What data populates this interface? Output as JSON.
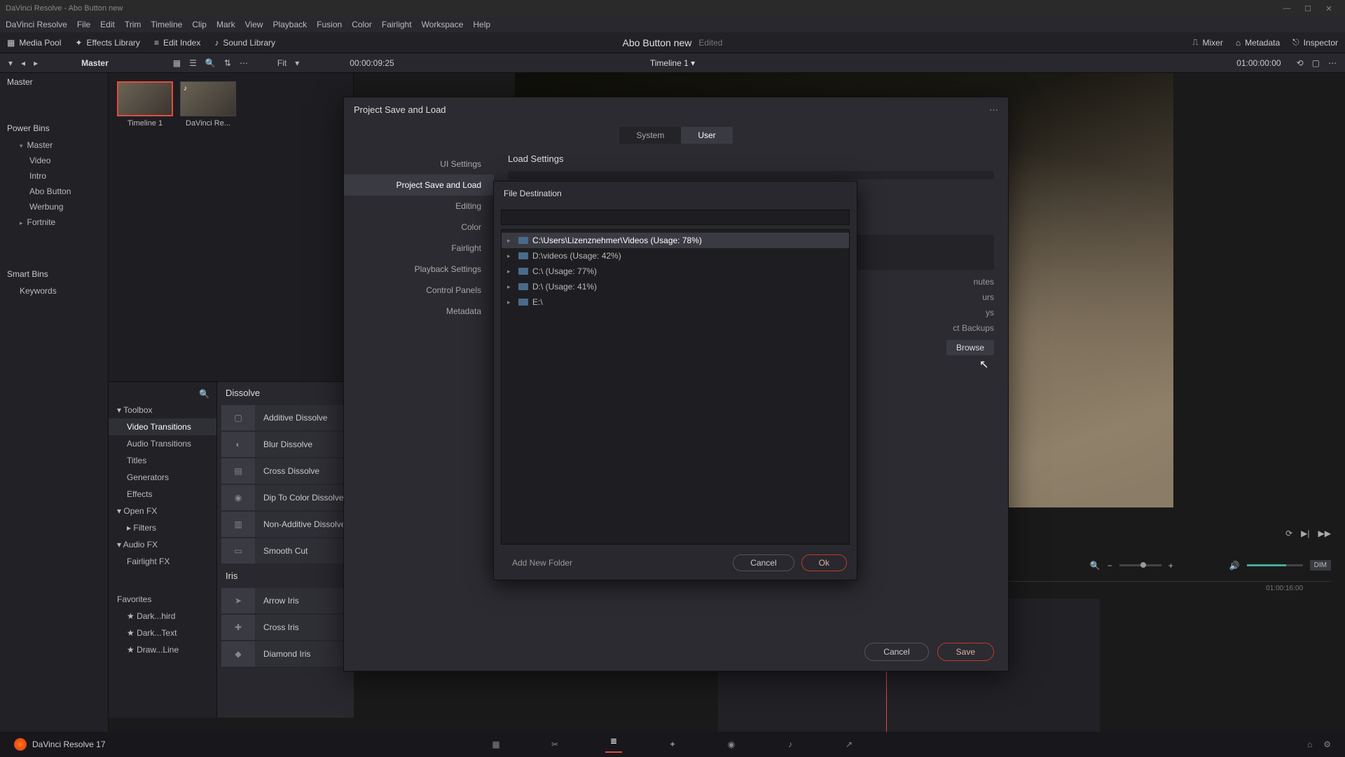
{
  "titlebar": {
    "text": "DaVinci Resolve - Abo Button new"
  },
  "menubar": [
    "DaVinci Resolve",
    "File",
    "Edit",
    "Trim",
    "Timeline",
    "Clip",
    "Mark",
    "View",
    "Playback",
    "Fusion",
    "Color",
    "Fairlight",
    "Workspace",
    "Help"
  ],
  "toolbar": {
    "media_pool": "Media Pool",
    "effects_library": "Effects Library",
    "edit_index": "Edit Index",
    "sound_library": "Sound Library",
    "project_name": "Abo Button new",
    "project_status": "Edited",
    "mixer": "Mixer",
    "metadata": "Metadata",
    "inspector": "Inspector"
  },
  "topstrip": {
    "master": "Master",
    "fit": "Fit",
    "tc_left": "00:00:09:25",
    "timeline": "Timeline 1",
    "tc_right": "01:00:00:00"
  },
  "media_tree": {
    "master_hdr": "Master",
    "power_bins": "Power Bins",
    "master": "Master",
    "items": [
      "Video",
      "Intro",
      "Abo Button",
      "Werbung",
      "Fortnite"
    ],
    "smart_bins": "Smart Bins",
    "keywords": "Keywords"
  },
  "thumbs": [
    {
      "label": "Timeline 1"
    },
    {
      "label": "DaVinci Re..."
    }
  ],
  "fx_tree": {
    "toolbox": "Toolbox",
    "items": [
      "Video Transitions",
      "Audio Transitions",
      "Titles",
      "Generators",
      "Effects"
    ],
    "openfx": "Open FX",
    "filters": "Filters",
    "audiofx": "Audio FX",
    "fairlightfx": "Fairlight FX",
    "favorites": "Favorites",
    "fav_items": [
      "Dark...hird",
      "Dark...Text",
      "Draw...Line"
    ]
  },
  "fx_list": {
    "dissolve_hdr": "Dissolve",
    "dissolve": [
      "Additive Dissolve",
      "Blur Dissolve",
      "Cross Dissolve",
      "Dip To Color Dissolve",
      "Non-Additive Dissolve",
      "Smooth Cut"
    ],
    "iris_hdr": "Iris",
    "iris": [
      "Arrow Iris",
      "Cross Iris",
      "Diamond Iris"
    ]
  },
  "ruler_tick": "01:00:16:00",
  "volume_dim": "DIM",
  "dialog": {
    "title": "Project Save and Load",
    "tabs": {
      "system": "System",
      "user": "User"
    },
    "nav": [
      "UI Settings",
      "Project Save and Load",
      "Editing",
      "Color",
      "Fairlight",
      "Playback Settings",
      "Control Panels",
      "Metadata"
    ],
    "nav_active": 1,
    "section": "Load Settings",
    "backup_lines": [
      "nutes",
      "urs",
      "ys",
      "ct Backups"
    ],
    "browse": "Browse",
    "cancel": "Cancel",
    "save": "Save"
  },
  "subdialog": {
    "title": "File Destination",
    "rows": [
      "C:\\Users\\Lizenznehmer\\Videos (Usage: 78%)",
      "D:\\videos (Usage: 42%)",
      "C:\\ (Usage: 77%)",
      "D:\\ (Usage: 41%)",
      "E:\\"
    ],
    "add": "Add New Folder",
    "cancel": "Cancel",
    "ok": "Ok"
  },
  "bottombar": {
    "app": "DaVinci Resolve 17"
  }
}
